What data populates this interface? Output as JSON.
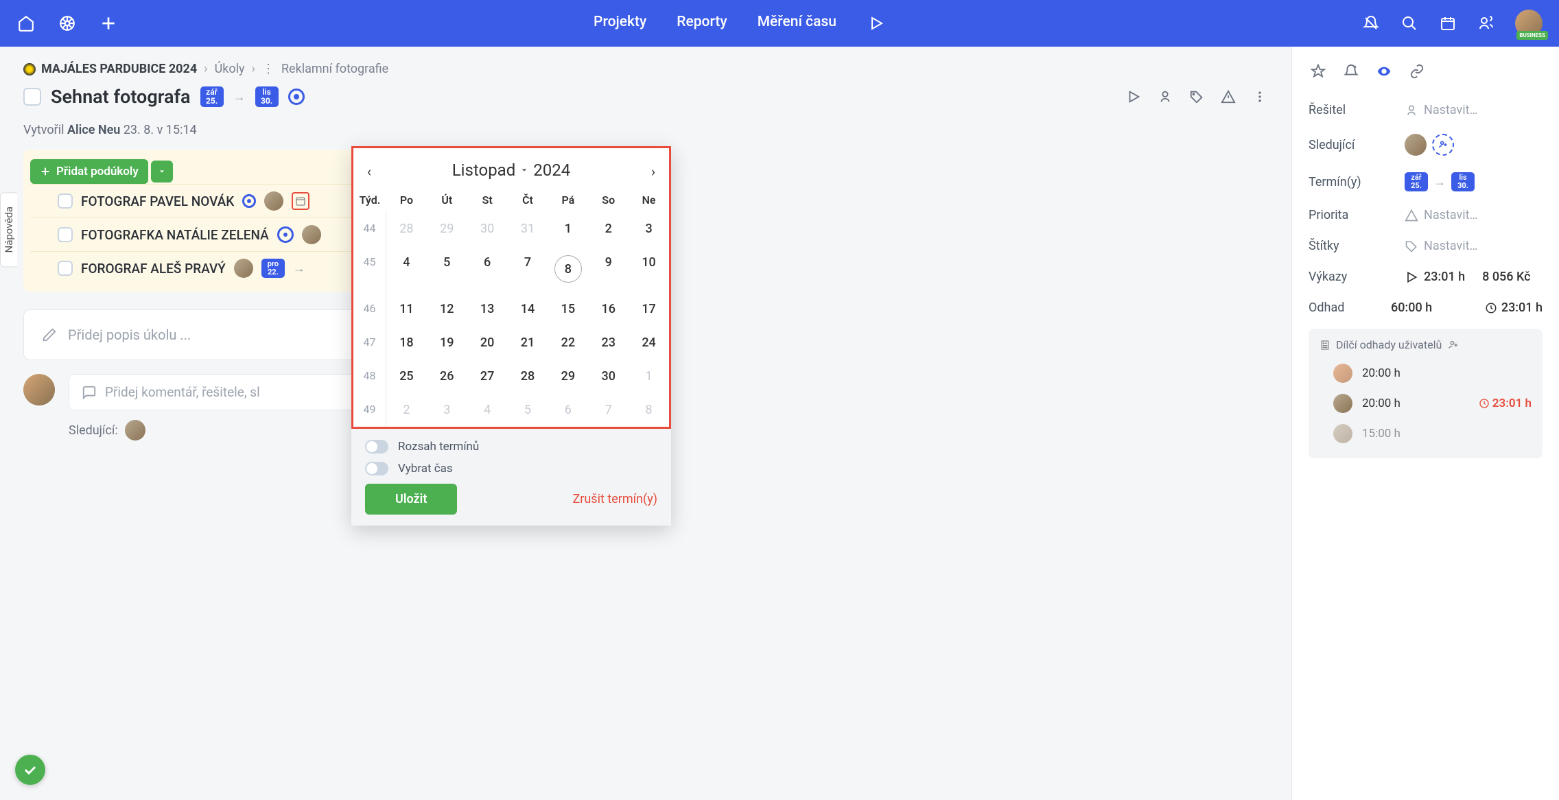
{
  "topnav": {
    "projekty": "Projekty",
    "reporty": "Reporty",
    "mereni": "Měření času",
    "badge": "BUSINESS"
  },
  "breadcrumb": {
    "project": "MAJÁLES PARDUBICE 2024",
    "tasks": "Úkoly",
    "current": "Reklamní fotografie"
  },
  "task": {
    "title": "Sehnat fotografa",
    "date1_m": "zář",
    "date1_d": "25.",
    "date2_m": "lis",
    "date2_d": "30.",
    "created_label": "Vytvořil",
    "created_by": "Alice Neu",
    "created_at": "23. 8. v 15:14"
  },
  "subtasks": {
    "add_label": "Přidat podúkoly",
    "rows": [
      {
        "name": "FOTOGRAF PAVEL NOVÁK"
      },
      {
        "name": "FOTOGRAFKA NATÁLIE ZELENÁ"
      },
      {
        "name": "FOROGRAF ALEŠ PRAVÝ",
        "badge_m": "pro",
        "badge_d": "22."
      }
    ]
  },
  "desc_placeholder": "Přidej popis úkolu ...",
  "comment_placeholder": "Přidej komentář, řešitele, sl",
  "watching_label": "Sledující:",
  "calendar": {
    "month": "Listopad",
    "year": "2024",
    "wk_label": "Týd.",
    "days": [
      "Po",
      "Út",
      "St",
      "Čt",
      "Pá",
      "So",
      "Ne"
    ],
    "weeks": [
      {
        "wk": "44",
        "d": [
          "28",
          "29",
          "30",
          "31",
          "1",
          "2",
          "3"
        ],
        "prev": [
          0,
          1,
          2,
          3
        ]
      },
      {
        "wk": "45",
        "d": [
          "4",
          "5",
          "6",
          "7",
          "8",
          "9",
          "10"
        ],
        "sel": 4
      },
      {
        "wk": "46",
        "d": [
          "11",
          "12",
          "13",
          "14",
          "15",
          "16",
          "17"
        ]
      },
      {
        "wk": "47",
        "d": [
          "18",
          "19",
          "20",
          "21",
          "22",
          "23",
          "24"
        ]
      },
      {
        "wk": "48",
        "d": [
          "25",
          "26",
          "27",
          "28",
          "29",
          "30",
          "1"
        ],
        "nxt": [
          6
        ]
      },
      {
        "wk": "49",
        "d": [
          "2",
          "3",
          "4",
          "5",
          "6",
          "7",
          "8"
        ],
        "nxt": [
          0,
          1,
          2,
          3,
          4,
          5,
          6
        ]
      }
    ],
    "toggle_range": "Rozsah termínů",
    "toggle_time": "Vybrat čas",
    "save": "Uložit",
    "cancel": "Zrušit termín(y)"
  },
  "sidebar": {
    "resitel": "Řešitel",
    "nastavit": "Nastavit…",
    "sledujici": "Sledující",
    "terminy": "Termín(y)",
    "date1_m": "zář",
    "date1_d": "25.",
    "date2_m": "lis",
    "date2_d": "30.",
    "priorita": "Priorita",
    "stitky": "Štítky",
    "vykazy": "Výkazy",
    "vykazy_h": "23:01 h",
    "vykazy_kc": "8 056 Kč",
    "odhad": "Odhad",
    "odhad_h": "60:00 h",
    "odhad_real": "23:01 h",
    "dilci": "Dílčí odhady uživatelů",
    "estimates": [
      {
        "t": "20:00 h",
        "real": ""
      },
      {
        "t": "20:00 h",
        "real": "23:01 h"
      },
      {
        "t": "15:00 h",
        "real": ""
      }
    ]
  },
  "help": "Nápověda"
}
